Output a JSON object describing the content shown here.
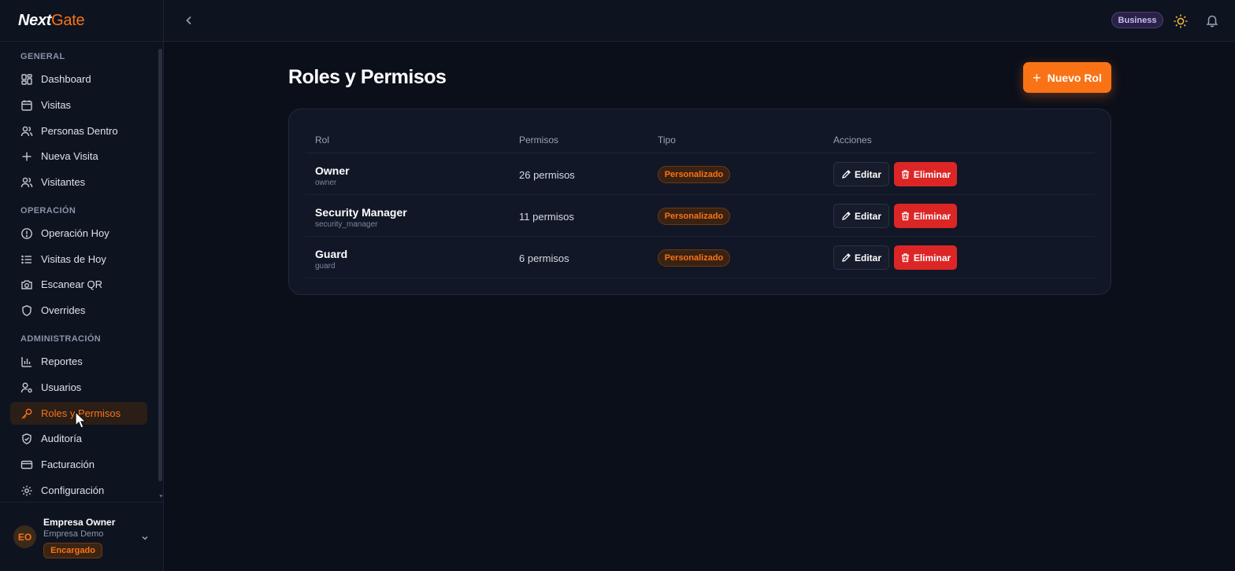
{
  "brand": {
    "part1": "Next",
    "part2": "Gate"
  },
  "sidebar": {
    "sections": [
      {
        "label": "GENERAL",
        "items": [
          {
            "label": "Dashboard",
            "icon": "dashboard-icon"
          },
          {
            "label": "Visitas",
            "icon": "calendar-icon"
          },
          {
            "label": "Personas Dentro",
            "icon": "users-icon"
          },
          {
            "label": "Nueva Visita",
            "icon": "plus-icon"
          },
          {
            "label": "Visitantes",
            "icon": "users-icon"
          }
        ]
      },
      {
        "label": "OPERACIÓN",
        "items": [
          {
            "label": "Operación Hoy",
            "icon": "alert-circle-icon"
          },
          {
            "label": "Visitas de Hoy",
            "icon": "list-icon"
          },
          {
            "label": "Escanear QR",
            "icon": "camera-icon"
          },
          {
            "label": "Overrides",
            "icon": "shield-icon"
          }
        ]
      },
      {
        "label": "ADMINISTRACIÓN",
        "items": [
          {
            "label": "Reportes",
            "icon": "bar-chart-icon"
          },
          {
            "label": "Usuarios",
            "icon": "user-cog-icon"
          },
          {
            "label": "Roles y Permisos",
            "icon": "key-icon",
            "active": true
          },
          {
            "label": "Auditoría",
            "icon": "shield-check-icon"
          },
          {
            "label": "Facturación",
            "icon": "credit-card-icon"
          },
          {
            "label": "Configuración",
            "icon": "gear-icon"
          }
        ]
      }
    ]
  },
  "user": {
    "initials": "EO",
    "name": "Empresa Owner",
    "company": "Empresa Demo",
    "badge": "Encargado"
  },
  "header": {
    "plan": "Business"
  },
  "main": {
    "title": "Roles y Permisos",
    "new_button": "Nuevo Rol",
    "columns": [
      "Rol",
      "Permisos",
      "Tipo",
      "Acciones"
    ],
    "edit_label": "Editar",
    "delete_label": "Eliminar",
    "rows": [
      {
        "name": "Owner",
        "key": "owner",
        "perms": "26 permisos",
        "type": "Personalizado"
      },
      {
        "name": "Security Manager",
        "key": "security_manager",
        "perms": "11 permisos",
        "type": "Personalizado"
      },
      {
        "name": "Guard",
        "key": "guard",
        "perms": "6 permisos",
        "type": "Personalizado"
      }
    ]
  },
  "colors": {
    "accent": "#f97316",
    "danger": "#dc2626",
    "background": "#0b0f1a"
  }
}
